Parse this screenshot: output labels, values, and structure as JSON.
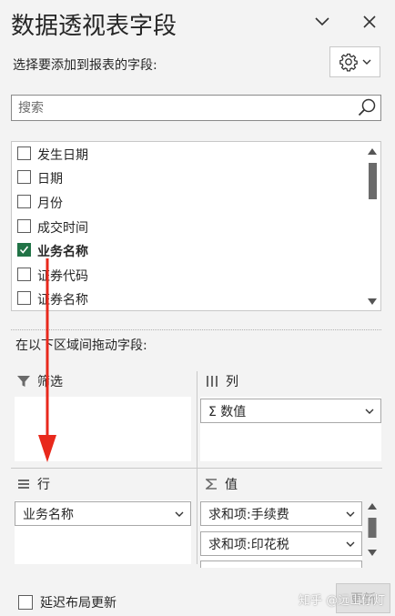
{
  "panel": {
    "title": "数据透视表字段",
    "subtitle": "选择要添加到报表的字段:"
  },
  "search": {
    "placeholder": "搜索",
    "value": ""
  },
  "fields": [
    {
      "label": "发生日期",
      "checked": false
    },
    {
      "label": "日期",
      "checked": false
    },
    {
      "label": "月份",
      "checked": false
    },
    {
      "label": "成交时间",
      "checked": false
    },
    {
      "label": "业务名称",
      "checked": true
    },
    {
      "label": "证券代码",
      "checked": false
    },
    {
      "label": "证券名称",
      "checked": false
    }
  ],
  "drag_hint": "在以下区域间拖动字段:",
  "areas": {
    "filters": {
      "label": "筛选",
      "items": []
    },
    "columns": {
      "label": "列",
      "items": [
        "Σ 数值"
      ]
    },
    "rows": {
      "label": "行",
      "items": [
        "业务名称"
      ]
    },
    "values": {
      "label": "值",
      "items": [
        "求和项:手续费",
        "求和项:印花税"
      ]
    }
  },
  "footer": {
    "defer_label": "延迟布局更新",
    "defer_checked": false,
    "update_label": "更新"
  },
  "watermark": "知乎 @远山仔灯",
  "colors": {
    "accent_green": "#217346",
    "annotation_red": "#e8291c",
    "panel_bg": "#f3f3f3"
  },
  "icons": {
    "collapse": "chevron-down-icon",
    "close": "close-icon",
    "settings": "gear-icon",
    "search": "search-icon",
    "filter": "filter-icon",
    "columns": "columns-icon",
    "rows": "rows-icon",
    "values": "sigma-icon"
  }
}
